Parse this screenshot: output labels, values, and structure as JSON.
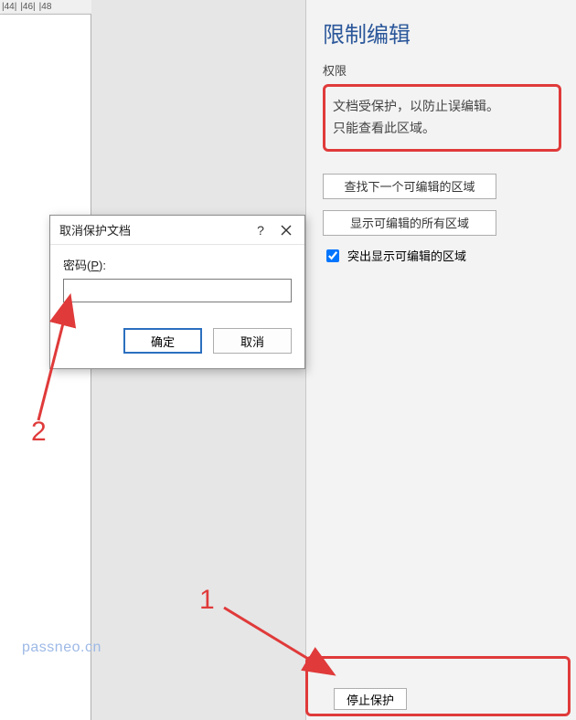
{
  "ruler": {
    "marks": [
      "|44|",
      "|46|",
      "|48"
    ]
  },
  "panel": {
    "title": "限制编辑",
    "section_label": "权限",
    "info_line1": "文档受保护，以防止误编辑。",
    "info_line2": "只能查看此区域。",
    "btn_find_next": "查找下一个可编辑的区域",
    "btn_show_all": "显示可编辑的所有区域",
    "checkbox_label": "突出显示可编辑的区域",
    "checkbox_checked": true,
    "stop_protect_label": "停止保护"
  },
  "dialog": {
    "title": "取消保护文档",
    "password_label_pre": "密码(",
    "password_label_key": "P",
    "password_label_post": "):",
    "password_value": "",
    "ok_label": "确定",
    "cancel_label": "取消"
  },
  "annotations": {
    "num1": "1",
    "num2": "2"
  },
  "watermark": "passneo.cn"
}
